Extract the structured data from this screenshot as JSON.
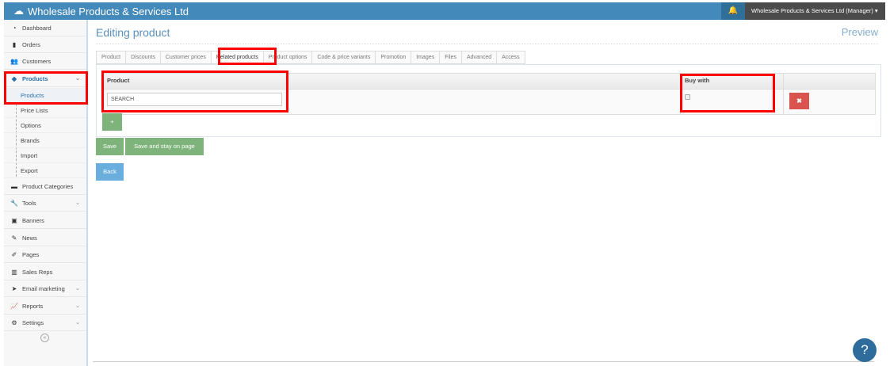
{
  "header": {
    "brand": "Wholesale Products & Services Ltd",
    "user": "Wholesale Products & Services Ltd (Manager)"
  },
  "sidebar": {
    "items": [
      {
        "label": "Dashboard",
        "icon": "dashboard-icon"
      },
      {
        "label": "Orders",
        "icon": "file-icon"
      },
      {
        "label": "Customers",
        "icon": "users-icon"
      },
      {
        "label": "Products",
        "icon": "tag-icon"
      },
      {
        "label": "Product Categories",
        "icon": "folder-icon"
      },
      {
        "label": "Tools",
        "icon": "wrench-icon"
      },
      {
        "label": "Banners",
        "icon": "image-icon"
      },
      {
        "label": "News",
        "icon": "pencil-icon"
      },
      {
        "label": "Pages",
        "icon": "edit-icon"
      },
      {
        "label": "Sales Reps",
        "icon": "briefcase-icon"
      },
      {
        "label": "Email marketing",
        "icon": "send-icon"
      },
      {
        "label": "Reports",
        "icon": "chart-icon"
      },
      {
        "label": "Settings",
        "icon": "gears-icon"
      }
    ],
    "sub": [
      "Products",
      "Price Lists",
      "Options",
      "Brands",
      "Import",
      "Export"
    ],
    "collapse": "«"
  },
  "main": {
    "title": "Editing product",
    "preview": "Preview",
    "tabs": [
      "Product",
      "Discounts",
      "Customer prices",
      "Related products",
      "Product options",
      "Code & price variants",
      "Promotion",
      "Images",
      "Files",
      "Advanced",
      "Access"
    ],
    "table": {
      "col_product": "Product",
      "col_buy_with": "Buy with",
      "search_value": "SEARCH"
    },
    "add": "+",
    "delete": "✖",
    "save": "Save",
    "save_stay": "Save and stay on page",
    "back": "Back",
    "help": "?"
  },
  "colors": {
    "topbar": "#4389b9",
    "accent": "#5b8fba",
    "green": "#7fb37c",
    "danger": "#d9534f"
  }
}
